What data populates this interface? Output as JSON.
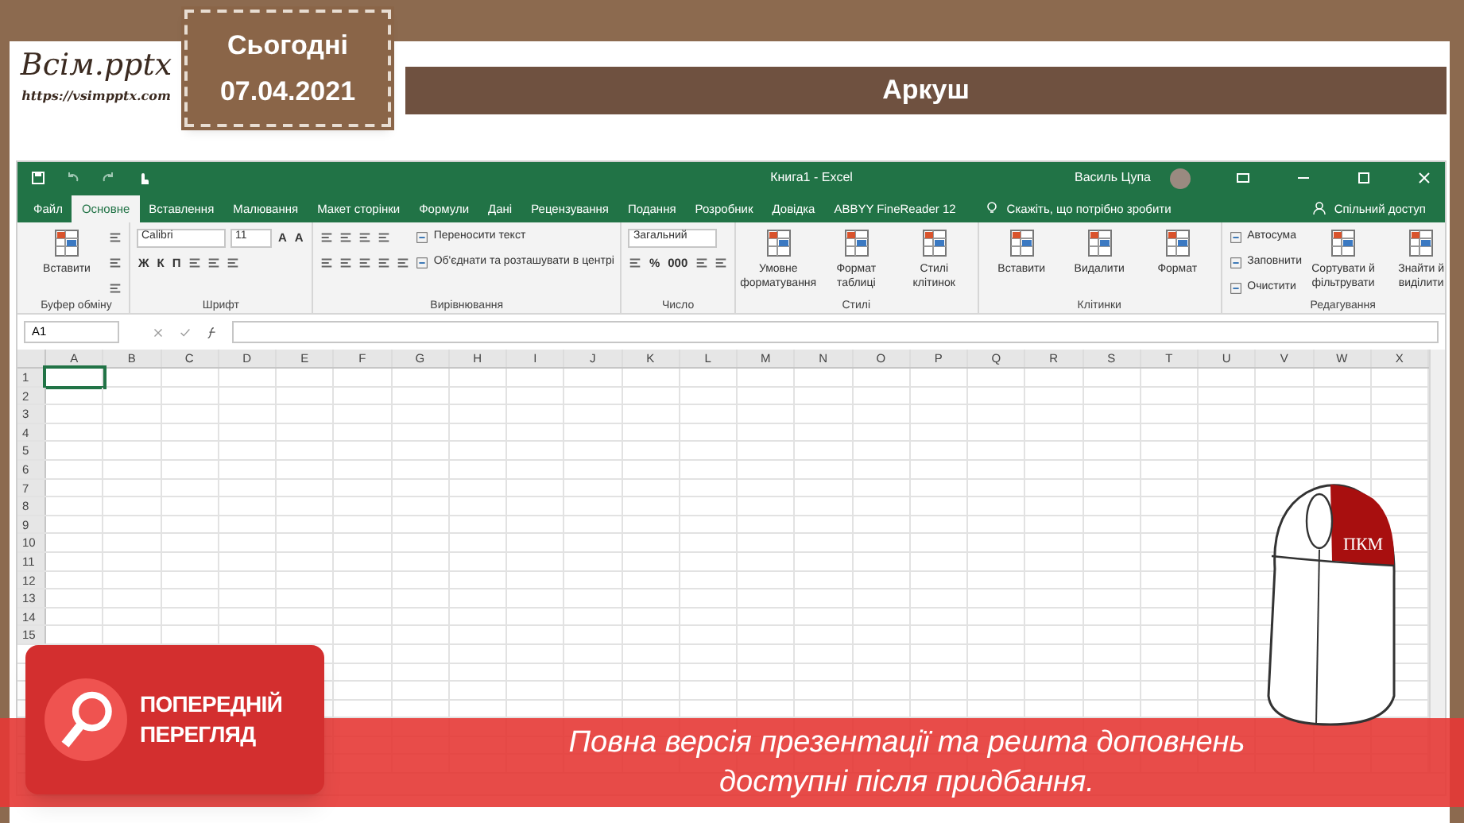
{
  "logo": {
    "title": "Всім.pptx",
    "url": "https://vsimpptx.com"
  },
  "date_tag": {
    "label": "Сьогодні",
    "date": "07.04.2021"
  },
  "slide_title": "Аркуш",
  "excel": {
    "title": "Книга1 - Excel",
    "user": "Василь Цупа",
    "tabs": [
      {
        "label": "Файл",
        "selected": false
      },
      {
        "label": "Основне",
        "selected": true
      },
      {
        "label": "Вставлення",
        "selected": false
      },
      {
        "label": "Малювання",
        "selected": false
      },
      {
        "label": "Макет сторінки",
        "selected": false
      },
      {
        "label": "Формули",
        "selected": false
      },
      {
        "label": "Дані",
        "selected": false
      },
      {
        "label": "Рецензування",
        "selected": false
      },
      {
        "label": "Подання",
        "selected": false
      },
      {
        "label": "Розробник",
        "selected": false
      },
      {
        "label": "Довідка",
        "selected": false
      },
      {
        "label": "ABBYY FineReader 12",
        "selected": false
      }
    ],
    "tell_me": "Скажіть, що потрібно зробити",
    "share": "Спільний доступ",
    "ribbon": [
      {
        "label": "Буфер обміну",
        "items": [
          {
            "kind": "large",
            "label": "Вставити"
          },
          {
            "kind": "stack",
            "lines": [
              {
                "controls": [
                  {
                    "kind": "icon"
                  }
                ]
              },
              {
                "controls": [
                  {
                    "kind": "icon"
                  }
                ]
              },
              {
                "controls": [
                  {
                    "kind": "icon"
                  }
                ]
              }
            ]
          }
        ]
      },
      {
        "label": "Шрифт",
        "items": [
          {
            "kind": "stack",
            "lines": [
              {
                "controls": [
                  {
                    "kind": "field",
                    "value": "Calibri"
                  },
                  {
                    "kind": "size_field",
                    "value": "11"
                  },
                  {
                    "kind": "glyph",
                    "label": "A"
                  },
                  {
                    "kind": "glyph",
                    "label": "A"
                  }
                ]
              },
              {
                "controls": [
                  {
                    "kind": "glyph",
                    "label": "Ж"
                  },
                  {
                    "kind": "glyph",
                    "label": "К"
                  },
                  {
                    "kind": "glyph",
                    "label": "П"
                  },
                  {
                    "kind": "icon"
                  },
                  {
                    "kind": "icon"
                  },
                  {
                    "kind": "icon"
                  }
                ]
              }
            ]
          }
        ]
      },
      {
        "label": "Вирівнювання",
        "items": [
          {
            "kind": "stack",
            "lines": [
              {
                "controls": [
                  {
                    "kind": "icon"
                  },
                  {
                    "kind": "icon"
                  },
                  {
                    "kind": "icon"
                  },
                  {
                    "kind": "icon"
                  }
                ]
              },
              {
                "controls": [
                  {
                    "kind": "icon"
                  },
                  {
                    "kind": "icon"
                  },
                  {
                    "kind": "icon"
                  },
                  {
                    "kind": "icon"
                  },
                  {
                    "kind": "icon"
                  }
                ]
              }
            ]
          },
          {
            "kind": "stack",
            "lines": [
              {
                "controls": [
                  {
                    "kind": "text",
                    "label": "Переносити текст"
                  }
                ]
              },
              {
                "controls": [
                  {
                    "kind": "text",
                    "label": "Об'єднати та розташувати в центрі"
                  }
                ]
              }
            ]
          }
        ]
      },
      {
        "label": "Число",
        "items": [
          {
            "kind": "stack",
            "lines": [
              {
                "controls": [
                  {
                    "kind": "field",
                    "value": "Загальний"
                  }
                ]
              },
              {
                "controls": [
                  {
                    "kind": "icon"
                  },
                  {
                    "kind": "glyph",
                    "label": "%"
                  },
                  {
                    "kind": "glyph",
                    "label": "000"
                  },
                  {
                    "kind": "icon"
                  },
                  {
                    "kind": "icon"
                  }
                ]
              }
            ]
          }
        ]
      },
      {
        "label": "Стилі",
        "items": [
          {
            "kind": "large",
            "label": "Умовне форматування"
          },
          {
            "kind": "large",
            "label": "Формат таблиці"
          },
          {
            "kind": "large",
            "label": "Стилі клітинок"
          }
        ]
      },
      {
        "label": "Клітинки",
        "items": [
          {
            "kind": "large",
            "label": "Вставити"
          },
          {
            "kind": "large",
            "label": "Видалити"
          },
          {
            "kind": "large",
            "label": "Формат"
          }
        ]
      },
      {
        "label": "Редагування",
        "items": [
          {
            "kind": "stack",
            "lines": [
              {
                "controls": [
                  {
                    "kind": "text",
                    "label": "Автосума"
                  }
                ]
              },
              {
                "controls": [
                  {
                    "kind": "text",
                    "label": "Заповнити"
                  }
                ]
              },
              {
                "controls": [
                  {
                    "kind": "text",
                    "label": "Очистити"
                  }
                ]
              }
            ]
          },
          {
            "kind": "large",
            "label": "Сортувати й фільтрувати"
          },
          {
            "kind": "large",
            "label": "Знайти й виділити"
          }
        ]
      }
    ],
    "name_box": "A1",
    "columns": [
      "A",
      "B",
      "C",
      "D",
      "E",
      "F",
      "G",
      "H",
      "I",
      "J",
      "K",
      "L",
      "M",
      "N",
      "O",
      "P",
      "Q",
      "R",
      "S",
      "T",
      "U",
      "V",
      "W",
      "X"
    ],
    "rows": [
      "1",
      "2",
      "3",
      "4",
      "5",
      "6",
      "7",
      "8",
      "9",
      "10",
      "11",
      "12",
      "13",
      "14",
      "15"
    ]
  },
  "mouse": {
    "label": "ПКМ"
  },
  "preview": {
    "badge": "ПОПЕРЕДНІЙ ПЕРЕГЛЯД",
    "notice": "Повна версія презентації та решта доповнень доступні після придбання."
  }
}
